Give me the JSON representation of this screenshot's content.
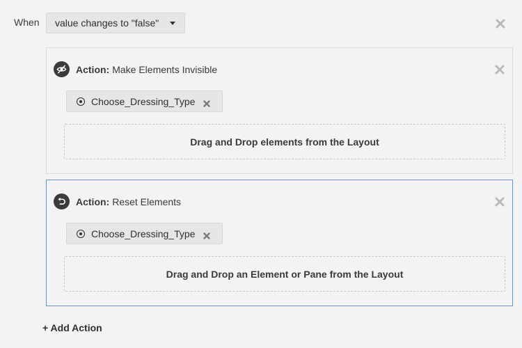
{
  "condition": {
    "when_label": "When",
    "selected_value": "value changes to \"false\""
  },
  "actions": [
    {
      "title_strong": "Action:",
      "title": "Make Elements Invisible",
      "icon": "eye-off-icon",
      "chip_label": "Choose_Dressing_Type",
      "dropzone_text": "Drag and Drop elements from the Layout"
    },
    {
      "title_strong": "Action:",
      "title": "Reset Elements",
      "icon": "reset-icon",
      "chip_label": "Choose_Dressing_Type",
      "dropzone_text": "Drag and Drop an Element or Pane from the Layout"
    }
  ],
  "add_action_label": "+ Add Action",
  "colors": {
    "background": "#f3f3f4",
    "selected_border": "#6d93c4",
    "icon_dark": "#3b3b3b",
    "close_gray": "#b9b9bc"
  }
}
